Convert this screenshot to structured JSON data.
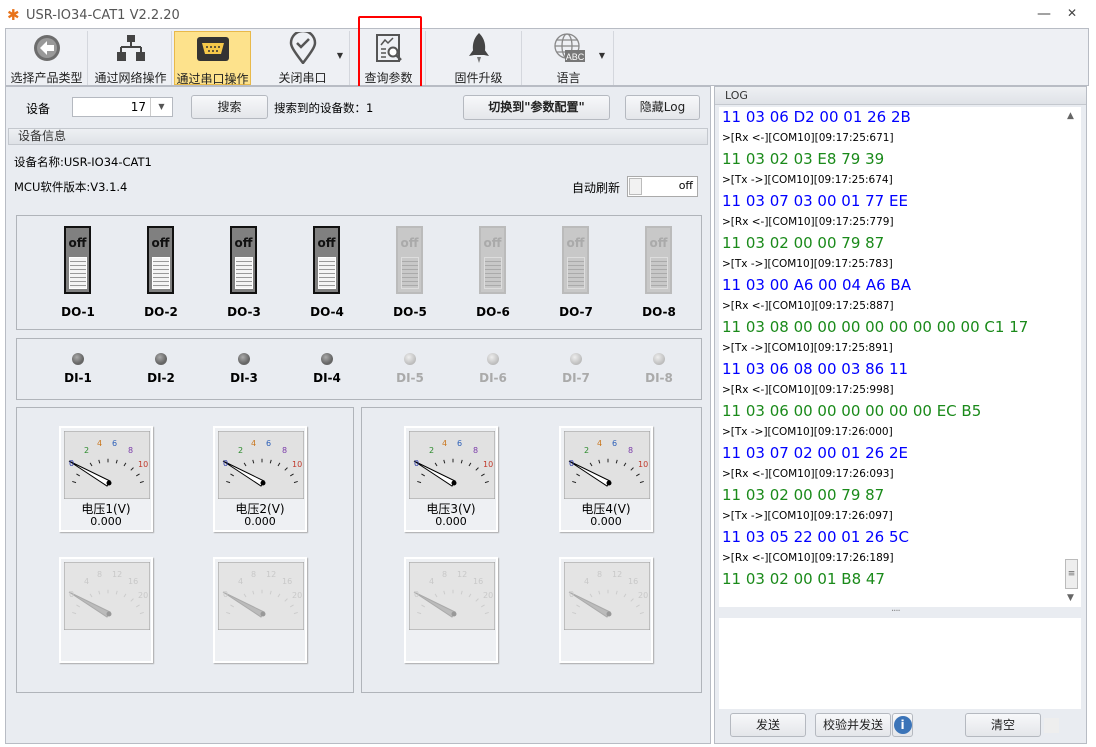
{
  "window": {
    "title": "USR-IO34-CAT1 V2.2.20",
    "minimize": "—",
    "maximize": "☐",
    "close": "✕"
  },
  "toolbar": [
    {
      "label": "选择产品类型",
      "icon": "back-arrow-icon"
    },
    {
      "label": "通过网络操作",
      "icon": "network-icon"
    },
    {
      "label": "通过串口操作",
      "icon": "serial-port-icon",
      "active": true
    },
    {
      "label": "关闭串口",
      "icon": "location-check-icon",
      "dropdown": true
    },
    {
      "label": "查询参数",
      "icon": "query-report-icon"
    },
    {
      "label": "固件升级",
      "icon": "rocket-icon"
    },
    {
      "label": "语言",
      "icon": "globe-abc-icon",
      "dropdown": true
    }
  ],
  "device_bar": {
    "device_label": "设备",
    "device_value": "17",
    "search_button": "搜索",
    "found_label": "搜索到的设备数：",
    "found_count": "1",
    "switch_button": "切换到\"参数配置\"",
    "hide_log_button": "隐藏Log"
  },
  "device_info": {
    "header": "设备信息",
    "name": "设备名称:USR-IO34-CAT1",
    "mcu": "MCU软件版本:V3.1.4",
    "auto_refresh_label": "自动刷新",
    "auto_refresh_state": "off"
  },
  "do_outputs": [
    {
      "label": "DO-1",
      "state": "off",
      "enabled": true
    },
    {
      "label": "DO-2",
      "state": "off",
      "enabled": true
    },
    {
      "label": "DO-3",
      "state": "off",
      "enabled": true
    },
    {
      "label": "DO-4",
      "state": "off",
      "enabled": true
    },
    {
      "label": "DO-5",
      "state": "off",
      "enabled": false
    },
    {
      "label": "DO-6",
      "state": "off",
      "enabled": false
    },
    {
      "label": "DO-7",
      "state": "off",
      "enabled": false
    },
    {
      "label": "DO-8",
      "state": "off",
      "enabled": false
    }
  ],
  "di_inputs": [
    {
      "label": "DI-1",
      "enabled": true
    },
    {
      "label": "DI-2",
      "enabled": true
    },
    {
      "label": "DI-3",
      "enabled": true
    },
    {
      "label": "DI-4",
      "enabled": true
    },
    {
      "label": "DI-5",
      "enabled": false
    },
    {
      "label": "DI-6",
      "enabled": false
    },
    {
      "label": "DI-7",
      "enabled": false
    },
    {
      "label": "DI-8",
      "enabled": false
    }
  ],
  "gauges": [
    {
      "name": "电压1(V)",
      "value": "0.000",
      "ticks": [
        "0",
        "2",
        "4",
        "6",
        "8",
        "10"
      ],
      "enabled": true
    },
    {
      "name": "电压2(V)",
      "value": "0.000",
      "ticks": [
        "0",
        "2",
        "4",
        "6",
        "8",
        "10"
      ],
      "enabled": true
    },
    {
      "name": "电压3(V)",
      "value": "0.000",
      "ticks": [
        "0",
        "2",
        "4",
        "6",
        "8",
        "10"
      ],
      "enabled": true
    },
    {
      "name": "电压4(V)",
      "value": "0.000",
      "ticks": [
        "0",
        "2",
        "4",
        "6",
        "8",
        "10"
      ],
      "enabled": true
    },
    {
      "ticks": [
        "0",
        "4",
        "8",
        "12",
        "16",
        "20"
      ],
      "enabled": false
    },
    {
      "ticks": [
        "0",
        "4",
        "8",
        "12",
        "16",
        "20"
      ],
      "enabled": false
    },
    {
      "ticks": [
        "0",
        "4",
        "8",
        "12",
        "16",
        "20"
      ],
      "enabled": false
    },
    {
      "ticks": [
        "0",
        "4",
        "8",
        "12",
        "16",
        "20"
      ],
      "enabled": false
    }
  ],
  "log": {
    "header": "LOG",
    "lines": [
      {
        "t": "11 03 06 D2 00 01 26 2B",
        "k": "tx"
      },
      {
        "t": ">[Rx <-][COM10][09:17:25:671]",
        "k": "meta"
      },
      {
        "t": "11 03 02 03 E8 79 39",
        "k": "rx"
      },
      {
        "t": ">[Tx ->][COM10][09:17:25:674]",
        "k": "meta"
      },
      {
        "t": "11 03 07 03 00 01 77 EE",
        "k": "tx"
      },
      {
        "t": ">[Rx <-][COM10][09:17:25:779]",
        "k": "meta"
      },
      {
        "t": "11 03 02 00 00 79 87",
        "k": "rx"
      },
      {
        "t": ">[Tx ->][COM10][09:17:25:783]",
        "k": "meta"
      },
      {
        "t": "11 03 00 A6 00 04 A6 BA",
        "k": "tx"
      },
      {
        "t": ">[Rx <-][COM10][09:17:25:887]",
        "k": "meta"
      },
      {
        "t": "11 03 08 00 00 00 00 00 00 00 00 C1 17",
        "k": "rx"
      },
      {
        "t": ">[Tx ->][COM10][09:17:25:891]",
        "k": "meta"
      },
      {
        "t": "11 03 06 08 00 03 86 11",
        "k": "tx"
      },
      {
        "t": ">[Rx <-][COM10][09:17:25:998]",
        "k": "meta"
      },
      {
        "t": "11 03 06 00 00 00 00 00 00 EC B5",
        "k": "rx"
      },
      {
        "t": ">[Tx ->][COM10][09:17:26:000]",
        "k": "meta"
      },
      {
        "t": "11 03 07 02 00 01 26 2E",
        "k": "tx"
      },
      {
        "t": ">[Rx <-][COM10][09:17:26:093]",
        "k": "meta"
      },
      {
        "t": "11 03 02 00 00 79 87",
        "k": "rx"
      },
      {
        "t": ">[Tx ->][COM10][09:17:26:097]",
        "k": "meta"
      },
      {
        "t": "11 03 05 22 00 01 26 5C",
        "k": "tx"
      },
      {
        "t": ">[Rx <-][COM10][09:17:26:189]",
        "k": "meta"
      },
      {
        "t": "11 03 02 00 01 B8 47",
        "k": "rx"
      }
    ],
    "send_button": "发送",
    "check_send_button": "校验并发送",
    "clear_button": "清空",
    "splitter": "....",
    "info_icon": "i"
  },
  "colors": {
    "tx": "#0000ff",
    "rx": "#1a8a1a",
    "active_tab": "#fde28c",
    "highlight_box": "#ff0000"
  }
}
